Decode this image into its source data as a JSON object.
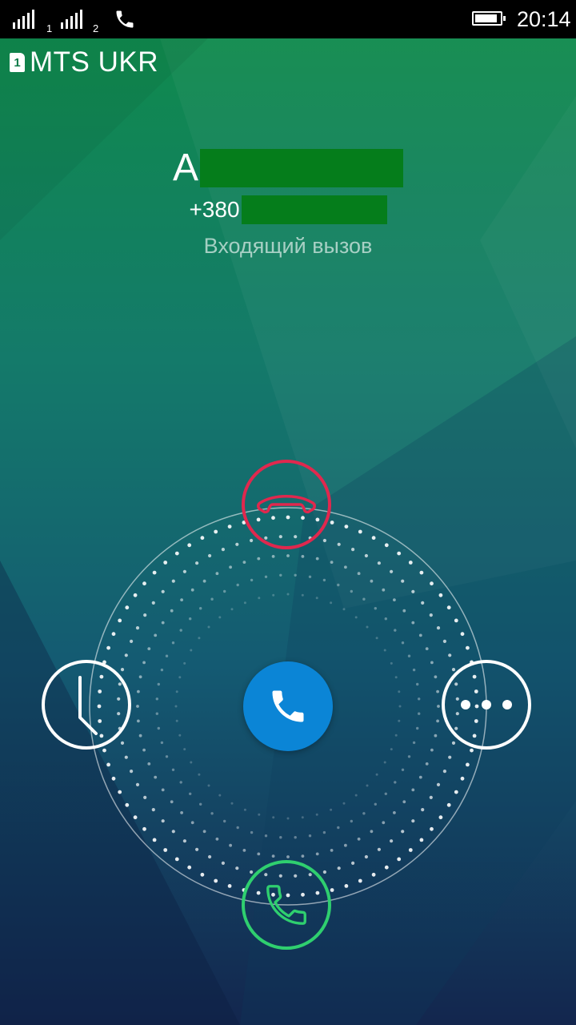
{
  "status_bar": {
    "sim1_label": "1",
    "sim2_label": "2",
    "icons": [
      "signal-sim1-icon",
      "signal-sim2-icon",
      "active-call-icon",
      "battery-icon"
    ],
    "battery_level": 0.9,
    "time": "20:14"
  },
  "carrier": {
    "sim_slot": "1",
    "name": "MTS UKR"
  },
  "caller": {
    "name_visible": "A",
    "number_visible": "+380",
    "status": "Входящий вызов"
  },
  "actions": {
    "decline_icon": "hang-up-icon",
    "accept_icon": "phone-icon",
    "remind_icon": "clock-icon",
    "more_icon": "more-dots-icon",
    "handle_icon": "phone-icon"
  },
  "colors": {
    "decline": "#e0284e",
    "accept": "#2fcf6f",
    "handle": "#0b85d6",
    "redaction": "#057d1b"
  }
}
